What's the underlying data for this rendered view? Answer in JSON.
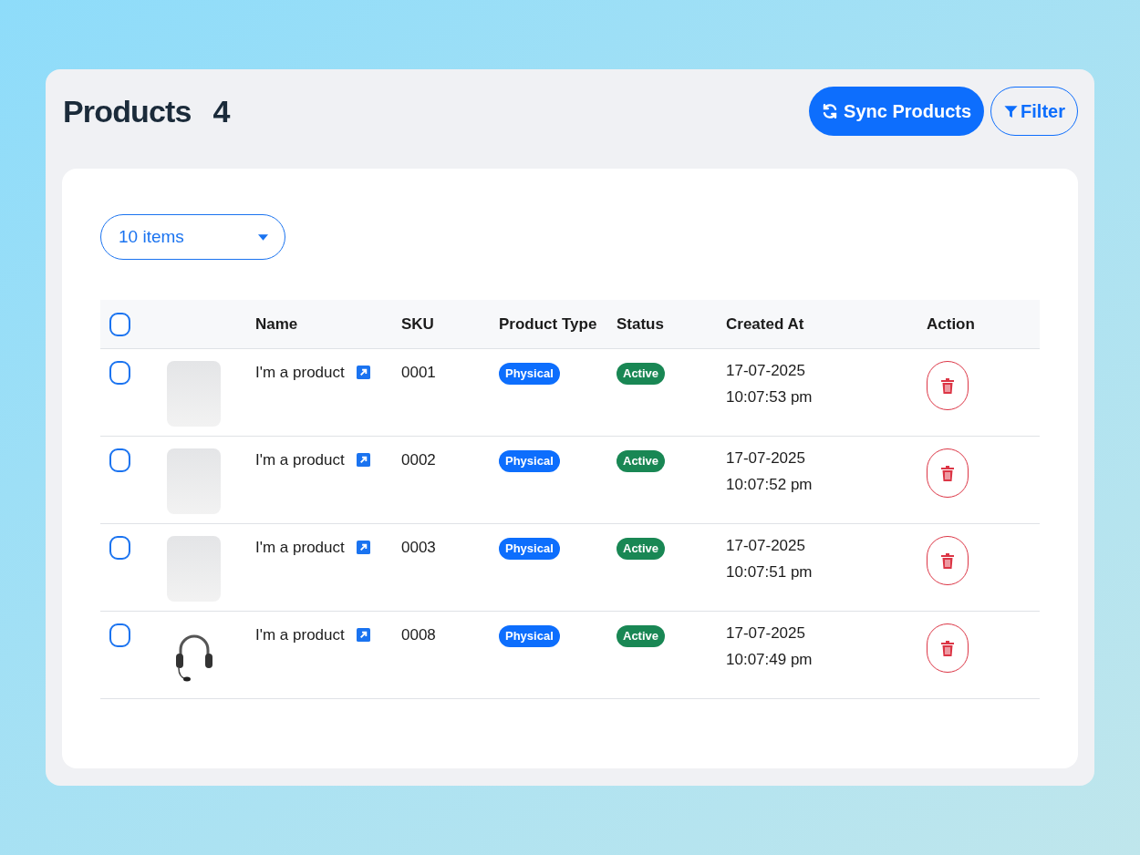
{
  "header": {
    "title": "Products",
    "count": "4",
    "buttons": [
      {
        "kind": "sync",
        "label": "Sync Products"
      },
      {
        "kind": "filter",
        "label": "Filter"
      }
    ]
  },
  "page_size": {
    "value": "10 items"
  },
  "table": {
    "select_all": {
      "checked": false
    },
    "columns": [
      "Name",
      "SKU",
      "Product Type",
      "Status",
      "Created At",
      "Action"
    ],
    "rows": [
      {
        "checked": false,
        "kind": "photo",
        "name": "I'm a product",
        "sku": "0001",
        "type": "Physical",
        "status": "Active",
        "date": "17-07-2025",
        "time": "10:07:53 pm"
      },
      {
        "checked": false,
        "kind": "photo",
        "name": "I'm a product",
        "sku": "0002",
        "type": "Physical",
        "status": "Active",
        "date": "17-07-2025",
        "time": "10:07:52 pm"
      },
      {
        "checked": false,
        "kind": "photo",
        "name": "I'm a product",
        "sku": "0003",
        "type": "Physical",
        "status": "Active",
        "date": "17-07-2025",
        "time": "10:07:51 pm"
      },
      {
        "checked": false,
        "kind": "drawing",
        "name": "I'm a product",
        "sku": "0008",
        "type": "Physical",
        "status": "Active",
        "date": "17-07-2025",
        "time": "10:07:49 pm"
      }
    ]
  }
}
